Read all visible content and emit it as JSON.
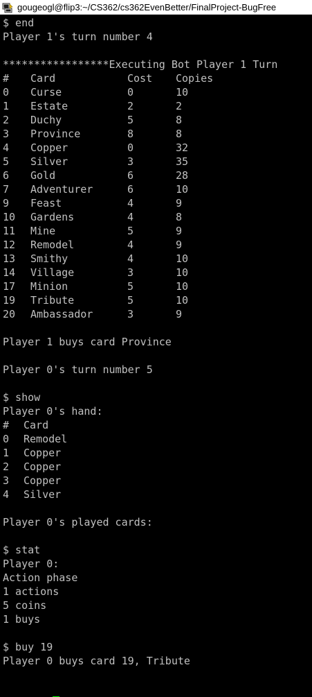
{
  "window": {
    "title": "gougeogl@flip3:~/CS362/cs362EvenBetter/FinalProject-BugFree",
    "icon": "putty-terminal-icon"
  },
  "terminal": {
    "colors": {
      "background": "#000000",
      "text": "#c0c0c0",
      "cursor": "#00ee00"
    },
    "lines_before_table": [
      "$ end",
      "Player 1's turn number 4",
      "",
      "*****************Executing Bot Player 1 Turn"
    ],
    "supply_table": {
      "headers": {
        "num": "#",
        "card": "Card",
        "cost": "Cost",
        "copies": "Copies"
      },
      "rows": [
        {
          "num": "0",
          "card": "Curse",
          "cost": "0",
          "copies": "10"
        },
        {
          "num": "1",
          "card": "Estate",
          "cost": "2",
          "copies": "2"
        },
        {
          "num": "2",
          "card": "Duchy",
          "cost": "5",
          "copies": "8"
        },
        {
          "num": "3",
          "card": "Province",
          "cost": "8",
          "copies": "8"
        },
        {
          "num": "4",
          "card": "Copper",
          "cost": "0",
          "copies": "32"
        },
        {
          "num": "5",
          "card": "Silver",
          "cost": "3",
          "copies": "35"
        },
        {
          "num": "6",
          "card": "Gold",
          "cost": "6",
          "copies": "28"
        },
        {
          "num": "7",
          "card": "Adventurer",
          "cost": "6",
          "copies": "10"
        },
        {
          "num": "9",
          "card": "Feast",
          "cost": "4",
          "copies": "9"
        },
        {
          "num": "10",
          "card": "Gardens",
          "cost": "4",
          "copies": "8"
        },
        {
          "num": "11",
          "card": "Mine",
          "cost": "5",
          "copies": "9"
        },
        {
          "num": "12",
          "card": "Remodel",
          "cost": "4",
          "copies": "9"
        },
        {
          "num": "13",
          "card": "Smithy",
          "cost": "4",
          "copies": "10"
        },
        {
          "num": "14",
          "card": "Village",
          "cost": "3",
          "copies": "10"
        },
        {
          "num": "17",
          "card": "Minion",
          "cost": "5",
          "copies": "10"
        },
        {
          "num": "19",
          "card": "Tribute",
          "cost": "5",
          "copies": "10"
        },
        {
          "num": "20",
          "card": "Ambassador",
          "cost": "3",
          "copies": "9"
        }
      ]
    },
    "lines_after_table": [
      "",
      "Player 1 buys card Province",
      "",
      "Player 0's turn number 5",
      "",
      "$ show",
      "Player 0's hand:"
    ],
    "hand_table": {
      "headers": {
        "num": "#",
        "card": "Card"
      },
      "rows": [
        {
          "num": "0",
          "card": "Remodel"
        },
        {
          "num": "1",
          "card": "Copper"
        },
        {
          "num": "2",
          "card": "Copper"
        },
        {
          "num": "3",
          "card": "Copper"
        },
        {
          "num": "4",
          "card": "Silver"
        }
      ]
    },
    "lines_after_hand": [
      "",
      "Player 0's played cards:",
      "",
      "$ stat",
      "Player 0:",
      "Action phase",
      "1 actions",
      "5 coins",
      "1 buys",
      "",
      "$ buy 19",
      "Player 0 buys card 19, Tribute",
      ""
    ],
    "prompt": {
      "symbol": "$",
      "input": ""
    }
  }
}
